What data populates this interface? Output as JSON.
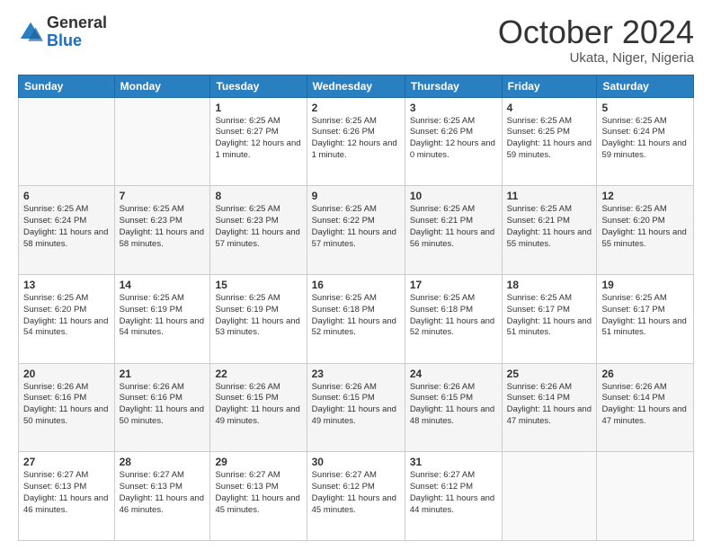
{
  "logo": {
    "general": "General",
    "blue": "Blue"
  },
  "title": "October 2024",
  "subtitle": "Ukata, Niger, Nigeria",
  "weekdays": [
    "Sunday",
    "Monday",
    "Tuesday",
    "Wednesday",
    "Thursday",
    "Friday",
    "Saturday"
  ],
  "weeks": [
    [
      {
        "day": "",
        "info": ""
      },
      {
        "day": "",
        "info": ""
      },
      {
        "day": "1",
        "info": "Sunrise: 6:25 AM\nSunset: 6:27 PM\nDaylight: 12 hours and 1 minute."
      },
      {
        "day": "2",
        "info": "Sunrise: 6:25 AM\nSunset: 6:26 PM\nDaylight: 12 hours and 1 minute."
      },
      {
        "day": "3",
        "info": "Sunrise: 6:25 AM\nSunset: 6:26 PM\nDaylight: 12 hours and 0 minutes."
      },
      {
        "day": "4",
        "info": "Sunrise: 6:25 AM\nSunset: 6:25 PM\nDaylight: 11 hours and 59 minutes."
      },
      {
        "day": "5",
        "info": "Sunrise: 6:25 AM\nSunset: 6:24 PM\nDaylight: 11 hours and 59 minutes."
      }
    ],
    [
      {
        "day": "6",
        "info": "Sunrise: 6:25 AM\nSunset: 6:24 PM\nDaylight: 11 hours and 58 minutes."
      },
      {
        "day": "7",
        "info": "Sunrise: 6:25 AM\nSunset: 6:23 PM\nDaylight: 11 hours and 58 minutes."
      },
      {
        "day": "8",
        "info": "Sunrise: 6:25 AM\nSunset: 6:23 PM\nDaylight: 11 hours and 57 minutes."
      },
      {
        "day": "9",
        "info": "Sunrise: 6:25 AM\nSunset: 6:22 PM\nDaylight: 11 hours and 57 minutes."
      },
      {
        "day": "10",
        "info": "Sunrise: 6:25 AM\nSunset: 6:21 PM\nDaylight: 11 hours and 56 minutes."
      },
      {
        "day": "11",
        "info": "Sunrise: 6:25 AM\nSunset: 6:21 PM\nDaylight: 11 hours and 55 minutes."
      },
      {
        "day": "12",
        "info": "Sunrise: 6:25 AM\nSunset: 6:20 PM\nDaylight: 11 hours and 55 minutes."
      }
    ],
    [
      {
        "day": "13",
        "info": "Sunrise: 6:25 AM\nSunset: 6:20 PM\nDaylight: 11 hours and 54 minutes."
      },
      {
        "day": "14",
        "info": "Sunrise: 6:25 AM\nSunset: 6:19 PM\nDaylight: 11 hours and 54 minutes."
      },
      {
        "day": "15",
        "info": "Sunrise: 6:25 AM\nSunset: 6:19 PM\nDaylight: 11 hours and 53 minutes."
      },
      {
        "day": "16",
        "info": "Sunrise: 6:25 AM\nSunset: 6:18 PM\nDaylight: 11 hours and 52 minutes."
      },
      {
        "day": "17",
        "info": "Sunrise: 6:25 AM\nSunset: 6:18 PM\nDaylight: 11 hours and 52 minutes."
      },
      {
        "day": "18",
        "info": "Sunrise: 6:25 AM\nSunset: 6:17 PM\nDaylight: 11 hours and 51 minutes."
      },
      {
        "day": "19",
        "info": "Sunrise: 6:25 AM\nSunset: 6:17 PM\nDaylight: 11 hours and 51 minutes."
      }
    ],
    [
      {
        "day": "20",
        "info": "Sunrise: 6:26 AM\nSunset: 6:16 PM\nDaylight: 11 hours and 50 minutes."
      },
      {
        "day": "21",
        "info": "Sunrise: 6:26 AM\nSunset: 6:16 PM\nDaylight: 11 hours and 50 minutes."
      },
      {
        "day": "22",
        "info": "Sunrise: 6:26 AM\nSunset: 6:15 PM\nDaylight: 11 hours and 49 minutes."
      },
      {
        "day": "23",
        "info": "Sunrise: 6:26 AM\nSunset: 6:15 PM\nDaylight: 11 hours and 49 minutes."
      },
      {
        "day": "24",
        "info": "Sunrise: 6:26 AM\nSunset: 6:15 PM\nDaylight: 11 hours and 48 minutes."
      },
      {
        "day": "25",
        "info": "Sunrise: 6:26 AM\nSunset: 6:14 PM\nDaylight: 11 hours and 47 minutes."
      },
      {
        "day": "26",
        "info": "Sunrise: 6:26 AM\nSunset: 6:14 PM\nDaylight: 11 hours and 47 minutes."
      }
    ],
    [
      {
        "day": "27",
        "info": "Sunrise: 6:27 AM\nSunset: 6:13 PM\nDaylight: 11 hours and 46 minutes."
      },
      {
        "day": "28",
        "info": "Sunrise: 6:27 AM\nSunset: 6:13 PM\nDaylight: 11 hours and 46 minutes."
      },
      {
        "day": "29",
        "info": "Sunrise: 6:27 AM\nSunset: 6:13 PM\nDaylight: 11 hours and 45 minutes."
      },
      {
        "day": "30",
        "info": "Sunrise: 6:27 AM\nSunset: 6:12 PM\nDaylight: 11 hours and 45 minutes."
      },
      {
        "day": "31",
        "info": "Sunrise: 6:27 AM\nSunset: 6:12 PM\nDaylight: 11 hours and 44 minutes."
      },
      {
        "day": "",
        "info": ""
      },
      {
        "day": "",
        "info": ""
      }
    ]
  ]
}
